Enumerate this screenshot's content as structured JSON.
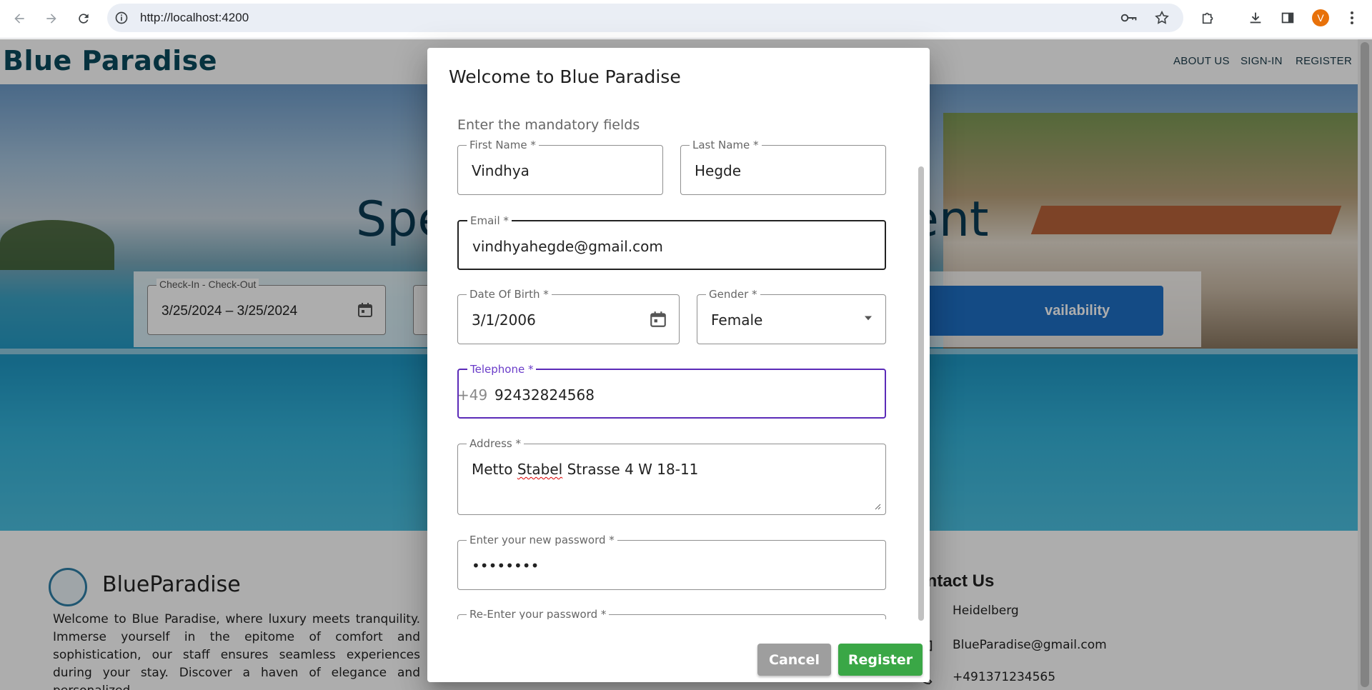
{
  "browser": {
    "url": "http://localhost:4200",
    "profile_initial": "V"
  },
  "page": {
    "brand": "Blue Paradise",
    "nav": [
      "ABOUT US",
      "SIGN-IN",
      "REGISTER"
    ],
    "hero_title_left": "Spe",
    "hero_title_right": "ent",
    "search": {
      "date_label": "Check-In - Check-Out",
      "date_value": "3/25/2024  – 3/25/2024",
      "availability_button": "vailability"
    },
    "footer": {
      "brand": "BlueParadise",
      "text": "Welcome to Blue Paradise, where luxury meets tranquility. Immerse yourself in the epitome of comfort and sophistication, our staff ensures seamless experiences during your stay. Discover a haven of elegance and personalized",
      "contact_title": "ontact Us",
      "contact_city": "Heidelberg",
      "contact_email": "BlueParadise@gmail.com",
      "contact_phone": "+491371234565"
    }
  },
  "dialog": {
    "title": "Welcome to Blue Paradise",
    "subtitle": "Enter the mandatory fields",
    "first_name": {
      "label": "First Name *",
      "value": "Vindhya"
    },
    "last_name": {
      "label": "Last Name *",
      "value": "Hegde"
    },
    "email": {
      "label": "Email *",
      "value": "vindhyahegde@gmail.com"
    },
    "dob": {
      "label": "Date Of Birth *",
      "value": "3/1/2006"
    },
    "gender": {
      "label": "Gender *",
      "value": "Female"
    },
    "telephone": {
      "label": "Telephone *",
      "prefix": "+49",
      "value": "92432824568"
    },
    "address": {
      "label": "Address *",
      "value_part1": "Metto",
      "value_part2": "Stabel",
      "value_part3": "Strasse 4 W 18-11"
    },
    "password": {
      "label": "Enter your new password *",
      "value": "••••••••"
    },
    "reenter_password": {
      "label": "Re-Enter your password *"
    },
    "cancel_label": "Cancel",
    "register_label": "Register"
  },
  "colors": {
    "brand": "#0a4b5e",
    "register_button": "#3aa746",
    "cancel_button": "#9e9e9e",
    "focus_purple": "#5b2bb8",
    "availability_button": "#1e6fc4"
  }
}
